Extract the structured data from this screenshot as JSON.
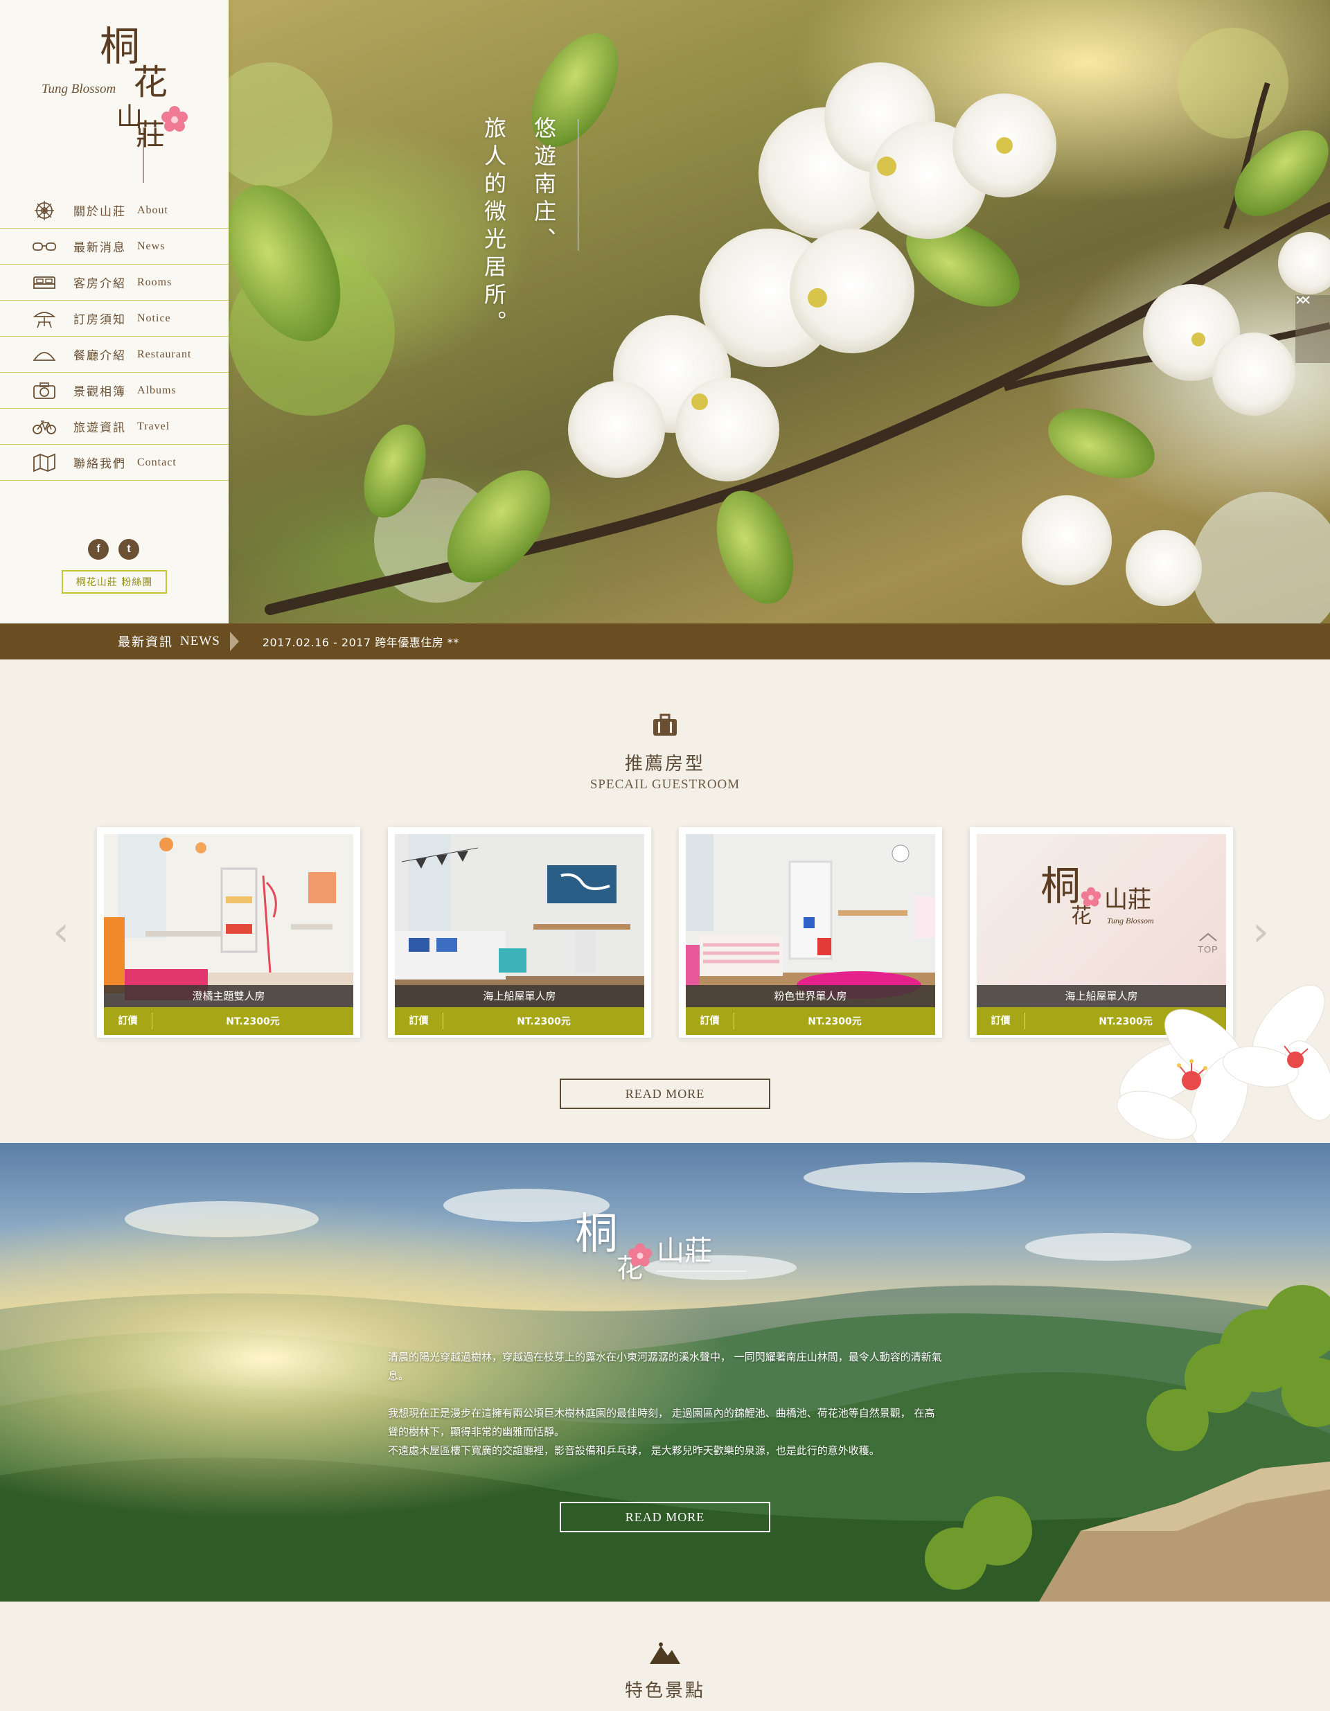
{
  "brand": {
    "zh": [
      "桐",
      "花",
      "山",
      "莊"
    ],
    "en": "Tung Blossom"
  },
  "hero": {
    "tagline_col1": "悠遊南庄、",
    "tagline_col2": "旅人的微光居所。"
  },
  "nav": {
    "items": [
      {
        "zh": "關於山莊",
        "en": "About",
        "icon": "dharma-wheel-icon"
      },
      {
        "zh": "最新消息",
        "en": "News",
        "icon": "glasses-icon"
      },
      {
        "zh": "客房介紹",
        "en": "Rooms",
        "icon": "bed-icon"
      },
      {
        "zh": "訂房須知",
        "en": "Notice",
        "icon": "umbrella-table-icon"
      },
      {
        "zh": "餐廳介紹",
        "en": "Restaurant",
        "icon": "dome-icon"
      },
      {
        "zh": "景觀相簿",
        "en": "Albums",
        "icon": "camera-icon"
      },
      {
        "zh": "旅遊資訊",
        "en": "Travel",
        "icon": "bicycle-icon"
      },
      {
        "zh": "聯絡我們",
        "en": "Contact",
        "icon": "map-icon"
      }
    ]
  },
  "social": {
    "facebook": "f",
    "twitter": "t"
  },
  "fanpage_label": "桐花山莊 粉絲團",
  "newsbar": {
    "label": "最新資訊",
    "label_en": "NEWS",
    "text": "2017.02.16 - 2017 跨年優惠住房 **"
  },
  "guestroom": {
    "title": "推薦房型",
    "subtitle": "SPECAIL GUESTROOM",
    "rooms": [
      {
        "name": "澄橘主題雙人房",
        "book": "訂價",
        "price": "NT.2300元"
      },
      {
        "name": "海上船屋單人房",
        "book": "訂價",
        "price": "NT.2300元"
      },
      {
        "name": "粉色世界單人房",
        "book": "訂價",
        "price": "NT.2300元"
      },
      {
        "name": "海上船屋單人房",
        "book": "訂價",
        "price": "NT.2300元"
      }
    ],
    "read_more": "READ MORE",
    "prev": "‹",
    "next": "›"
  },
  "placeholder_logo": {
    "zh": [
      "桐",
      "花",
      "山莊"
    ],
    "en": "Tung Blossom"
  },
  "top_label": "TOP",
  "landscape": {
    "logo": [
      "桐",
      "花",
      "山莊"
    ],
    "para1": "清晨的陽光穿越過樹林，穿越過在枝芽上的露水在小東河潺潺的溪水聲中， 一同閃耀著南庄山林間，最令人動容的清新氣息。",
    "para2_line1": "我想現在正是漫步在這擁有兩公頃巨木樹林庭園的最佳時刻， 走過園區內的錦鯉池、曲橋池、荷花池等自然景觀， 在高聳的樹林下，顯得非常的幽雅而恬靜。",
    "para2_line2": "不遠處木屋區樓下寬廣的交誼廳裡，影音設備和乒乓球， 是大夥兒昨天歡樂的泉源，也是此行的意外收穫。",
    "read_more": "READ MORE"
  },
  "attractions": {
    "title": "特色景點"
  },
  "colors": {
    "accent": "#a6a617",
    "brown": "#6a4e22",
    "text": "#5b4a35"
  }
}
